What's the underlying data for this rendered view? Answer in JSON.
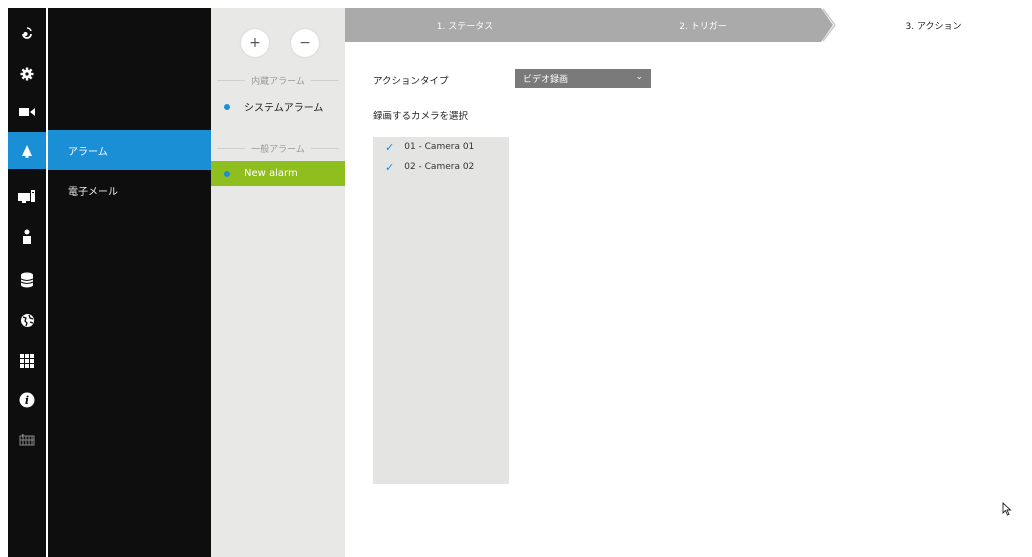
{
  "rail": {
    "items": [
      {
        "name": "logo-icon"
      },
      {
        "name": "gear-icon"
      },
      {
        "name": "camera-icon"
      },
      {
        "name": "bell-icon"
      },
      {
        "name": "monitor-icon"
      },
      {
        "name": "user-icon"
      },
      {
        "name": "database-icon"
      },
      {
        "name": "globe-icon"
      },
      {
        "name": "grid-icon"
      },
      {
        "name": "info-icon"
      },
      {
        "name": "calendar-icon"
      }
    ],
    "active_color": "#1a8fd6"
  },
  "submenu": {
    "items": [
      {
        "label": "アラーム",
        "active": true
      },
      {
        "label": "電子メール",
        "active": false
      }
    ]
  },
  "alarms": {
    "add_label": "+",
    "remove_label": "−",
    "builtin_section": "内蔵アラーム",
    "builtin_items": [
      {
        "label": "システムアラーム"
      }
    ],
    "general_section": "一般アラーム",
    "general_items": [
      {
        "label": "New alarm",
        "active": true
      }
    ],
    "active_color": "#8fbf1f"
  },
  "steps": [
    {
      "label": "1. ステータス"
    },
    {
      "label": "2. トリガー"
    },
    {
      "label": "3. アクション"
    }
  ],
  "action": {
    "type_label": "アクションタイプ",
    "type_value": "ビデオ録画",
    "camera_label": "録画するカメラを選択",
    "cameras": [
      {
        "label": "01 - Camera 01",
        "checked": true
      },
      {
        "label": "02 - Camera 02",
        "checked": true
      }
    ]
  }
}
